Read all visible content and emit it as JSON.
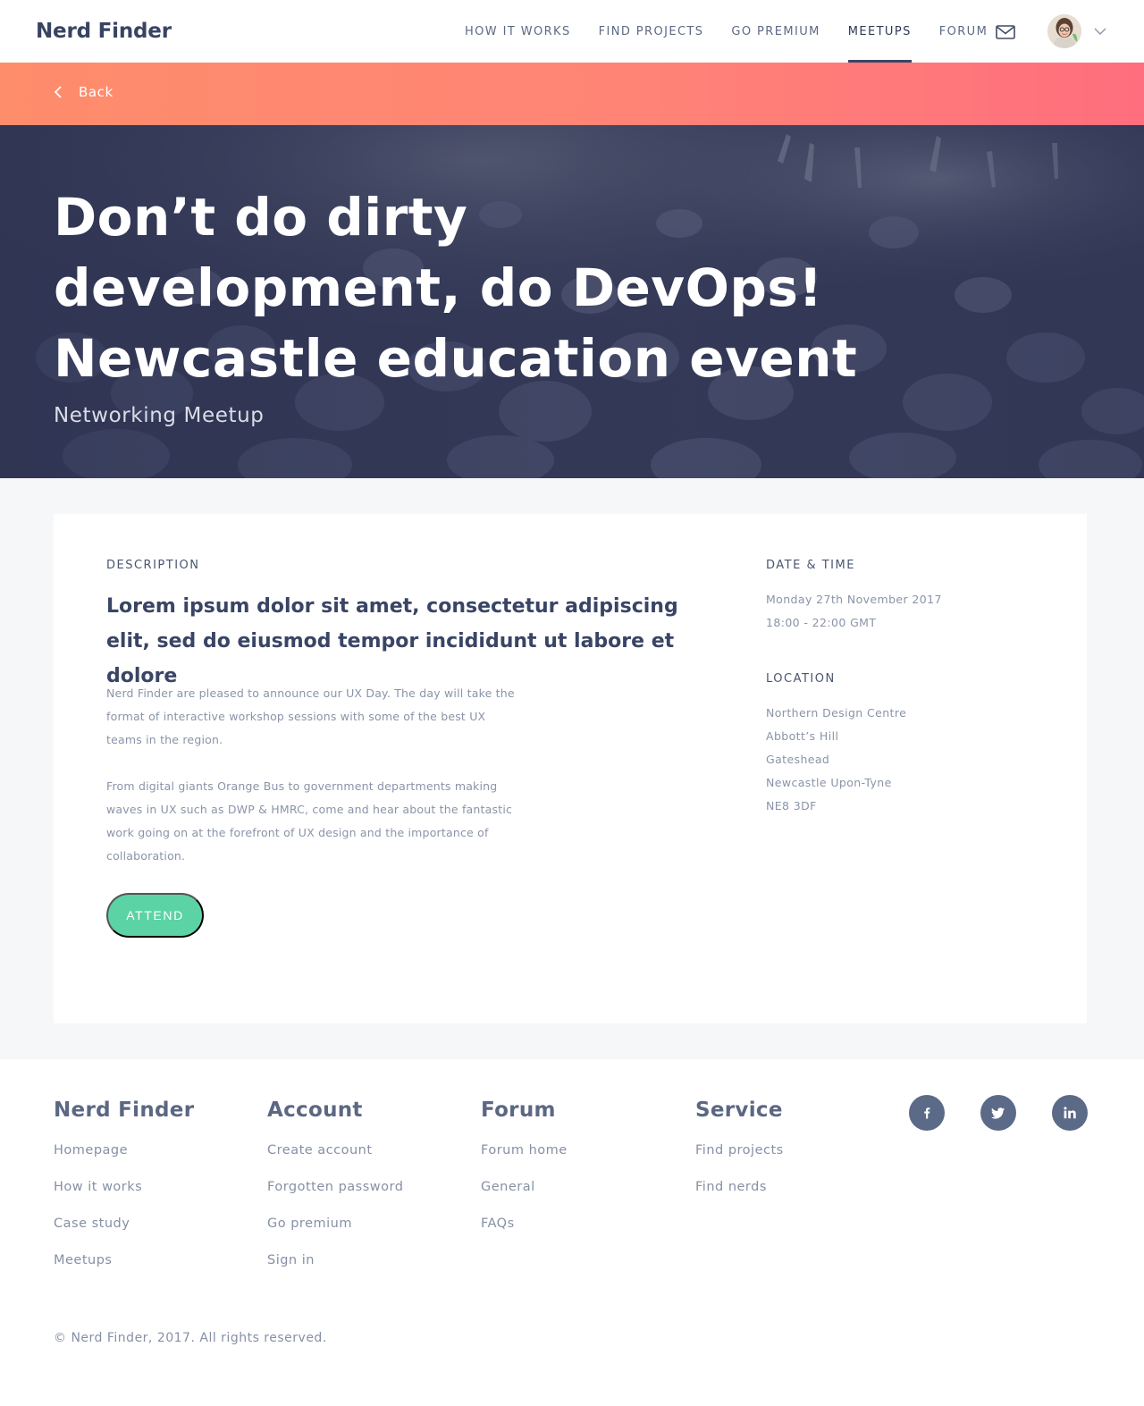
{
  "brand": "Nerd Finder",
  "nav": {
    "links": [
      {
        "label": "HOW IT WORKS",
        "active": false
      },
      {
        "label": "FIND PROJECTS",
        "active": false
      },
      {
        "label": "GO PREMIUM",
        "active": false
      },
      {
        "label": "MEETUPS",
        "active": true
      },
      {
        "label": "FORUM",
        "active": false
      }
    ],
    "mail_icon": "mail-icon",
    "avatar_icon": "user-avatar",
    "menu_icon": "chevron-down-icon"
  },
  "backbar": {
    "label": "Back"
  },
  "hero": {
    "title": "Don’t do dirty development, do DevOps!  Newcastle education event",
    "subtitle": "Networking Meetup"
  },
  "description": {
    "label": "DESCRIPTION",
    "lead": "Lorem ipsum dolor sit amet, consectetur adipiscing elit, sed do eiusmod tempor incididunt ut labore et dolore",
    "paragraphs": [
      "Nerd Finder are pleased to announce our UX Day. The day will take the format of interactive workshop sessions with some of the best UX teams in the region.",
      "From digital giants Orange Bus to government departments making waves in UX such as DWP & HMRC, come and hear about the fantastic work going on at the forefront of UX design and the importance of collaboration."
    ],
    "attend_label": "ATTEND"
  },
  "datetime": {
    "label": "DATE & TIME",
    "date": "Monday 27th November 2017",
    "time": "18:00 - 22:00 GMT"
  },
  "location": {
    "label": "LOCATION",
    "lines": [
      "Northern Design Centre",
      "Abbott’s Hill",
      "Gateshead",
      "Newcastle Upon-Tyne",
      "NE8 3DF"
    ]
  },
  "footer": {
    "columns": [
      {
        "heading": "Nerd Finder",
        "items": [
          "Homepage",
          "How it works",
          "Case study",
          "Meetups"
        ]
      },
      {
        "heading": "Account",
        "items": [
          "Create account",
          "Forgotten password",
          "Go premium",
          "Sign in"
        ]
      },
      {
        "heading": "Forum",
        "items": [
          "Forum home",
          "General",
          "FAQs"
        ]
      },
      {
        "heading": "Service",
        "items": [
          "Find projects",
          "Find nerds"
        ]
      }
    ],
    "social": [
      "facebook-icon",
      "twitter-icon",
      "linkedin-icon"
    ],
    "copyright": "© Nerd Finder, 2017. All rights reserved."
  },
  "colors": {
    "accent_green": "#5bd3a5",
    "gradient_start": "#fe8d6b",
    "gradient_end": "#ff6e7e",
    "navy": "#394463"
  }
}
